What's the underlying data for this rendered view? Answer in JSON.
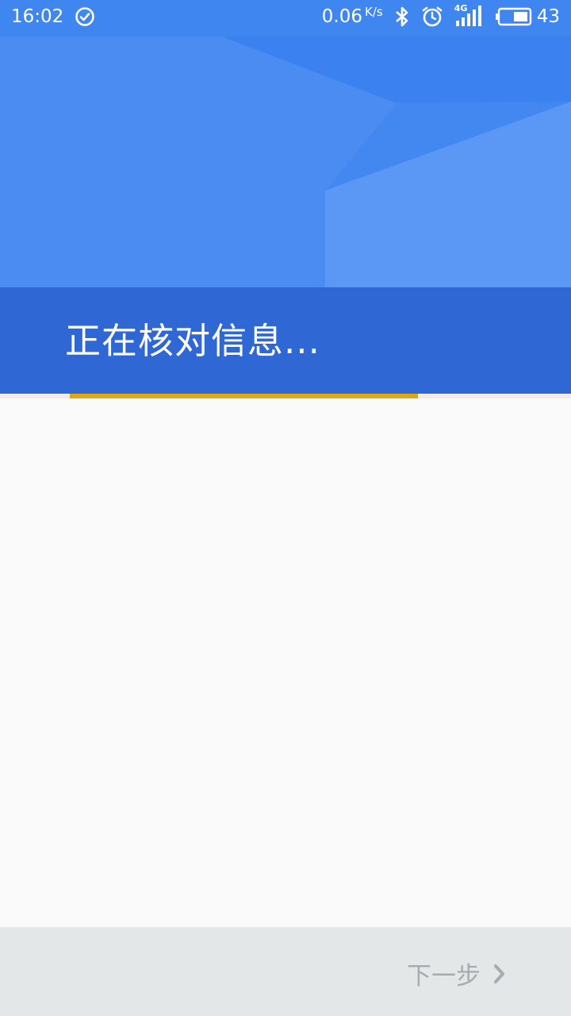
{
  "status_bar": {
    "time": "16:02",
    "net_speed": "0.06",
    "net_speed_unit": "K/s",
    "network_type": "4G",
    "battery_level": "43",
    "icons": [
      "check-circle-icon",
      "bluetooth-icon",
      "alarm-icon",
      "signal-icon",
      "battery-icon"
    ]
  },
  "header": {
    "title": "正在核对信息..."
  },
  "progress": {
    "fraction": 0.61
  },
  "footer": {
    "next_label": "下一步",
    "next_icon": "chevron-right-icon"
  },
  "colors": {
    "header_blue": "#3d85f0",
    "title_band_blue": "#2f67d4",
    "progress_gold": "#e0a613",
    "footer_gray": "#e4e7e7",
    "disabled_text": "#a6abad"
  }
}
